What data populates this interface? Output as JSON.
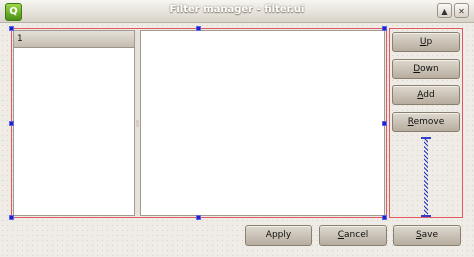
{
  "window": {
    "title": "Filter manager - filter.ui",
    "icon": "qt-designer-icon",
    "controls": {
      "minimize": "▲",
      "close": "✕"
    }
  },
  "list": {
    "header": "1"
  },
  "side_buttons": [
    {
      "label": "Up",
      "mnemonic": "U"
    },
    {
      "label": "Down",
      "mnemonic": "D"
    },
    {
      "label": "Add",
      "mnemonic": "A"
    },
    {
      "label": "Remove",
      "mnemonic": "R"
    }
  ],
  "bottom_buttons": {
    "apply": "Apply",
    "cancel": "Cancel",
    "save": "Save"
  },
  "colors": {
    "layout_outline": "#e2585d",
    "selection_handle": "#1c23c8",
    "spacer": "#2332c0"
  }
}
